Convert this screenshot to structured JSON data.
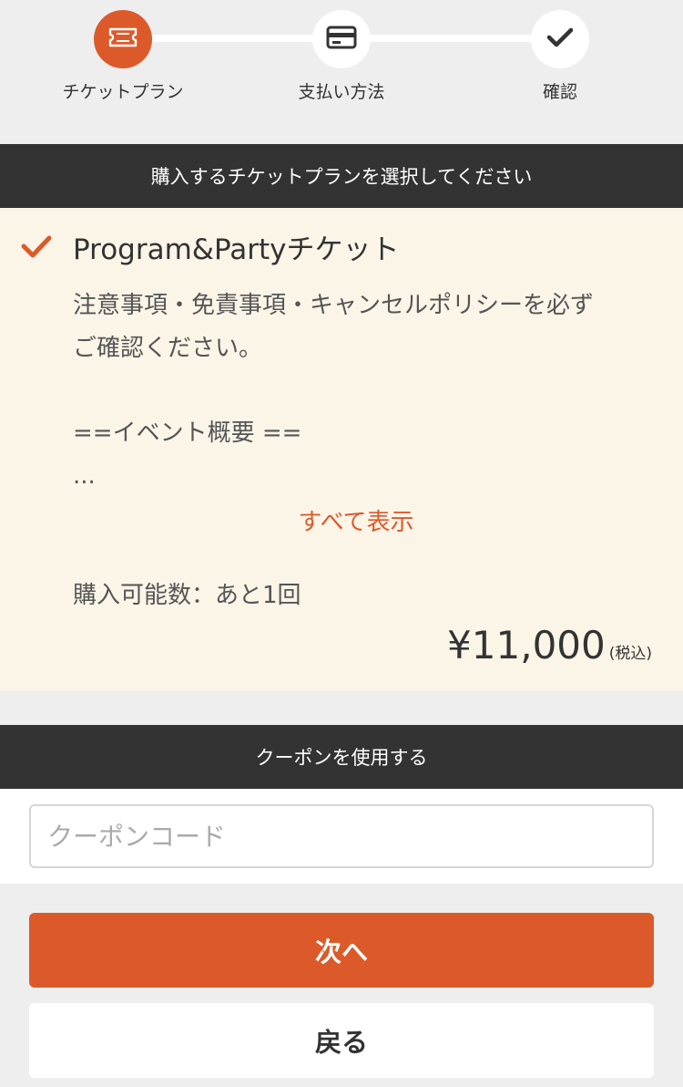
{
  "stepper": {
    "steps": [
      {
        "label": "チケットプラン",
        "icon": "ticket-icon",
        "active": true
      },
      {
        "label": "支払い方法",
        "icon": "credit-card-icon",
        "active": false
      },
      {
        "label": "確認",
        "icon": "checkmark-icon",
        "active": false
      }
    ]
  },
  "plan_section": {
    "header": "購入するチケットプランを選択してください",
    "plan": {
      "name": "Program&Partyチケット",
      "description_lines": [
        "注意事項・免責事項・キャンセルポリシーを必ず",
        "ご確認ください。",
        "==イベント概要 ==",
        "..."
      ],
      "show_all": "すべて表示",
      "remaining": "購入可能数：あと1回",
      "price": "¥11,000",
      "tax_note": "(税込)",
      "selected": true
    }
  },
  "coupon_section": {
    "header": "クーポンを使用する",
    "input_placeholder": "クーポンコード",
    "input_value": ""
  },
  "actions": {
    "next_label": "次へ",
    "back_label": "戻る"
  },
  "colors": {
    "accent": "#dc5a2a",
    "header_bar": "#333333",
    "card_background": "#fbf5e8",
    "page_background": "#eeeeee"
  }
}
